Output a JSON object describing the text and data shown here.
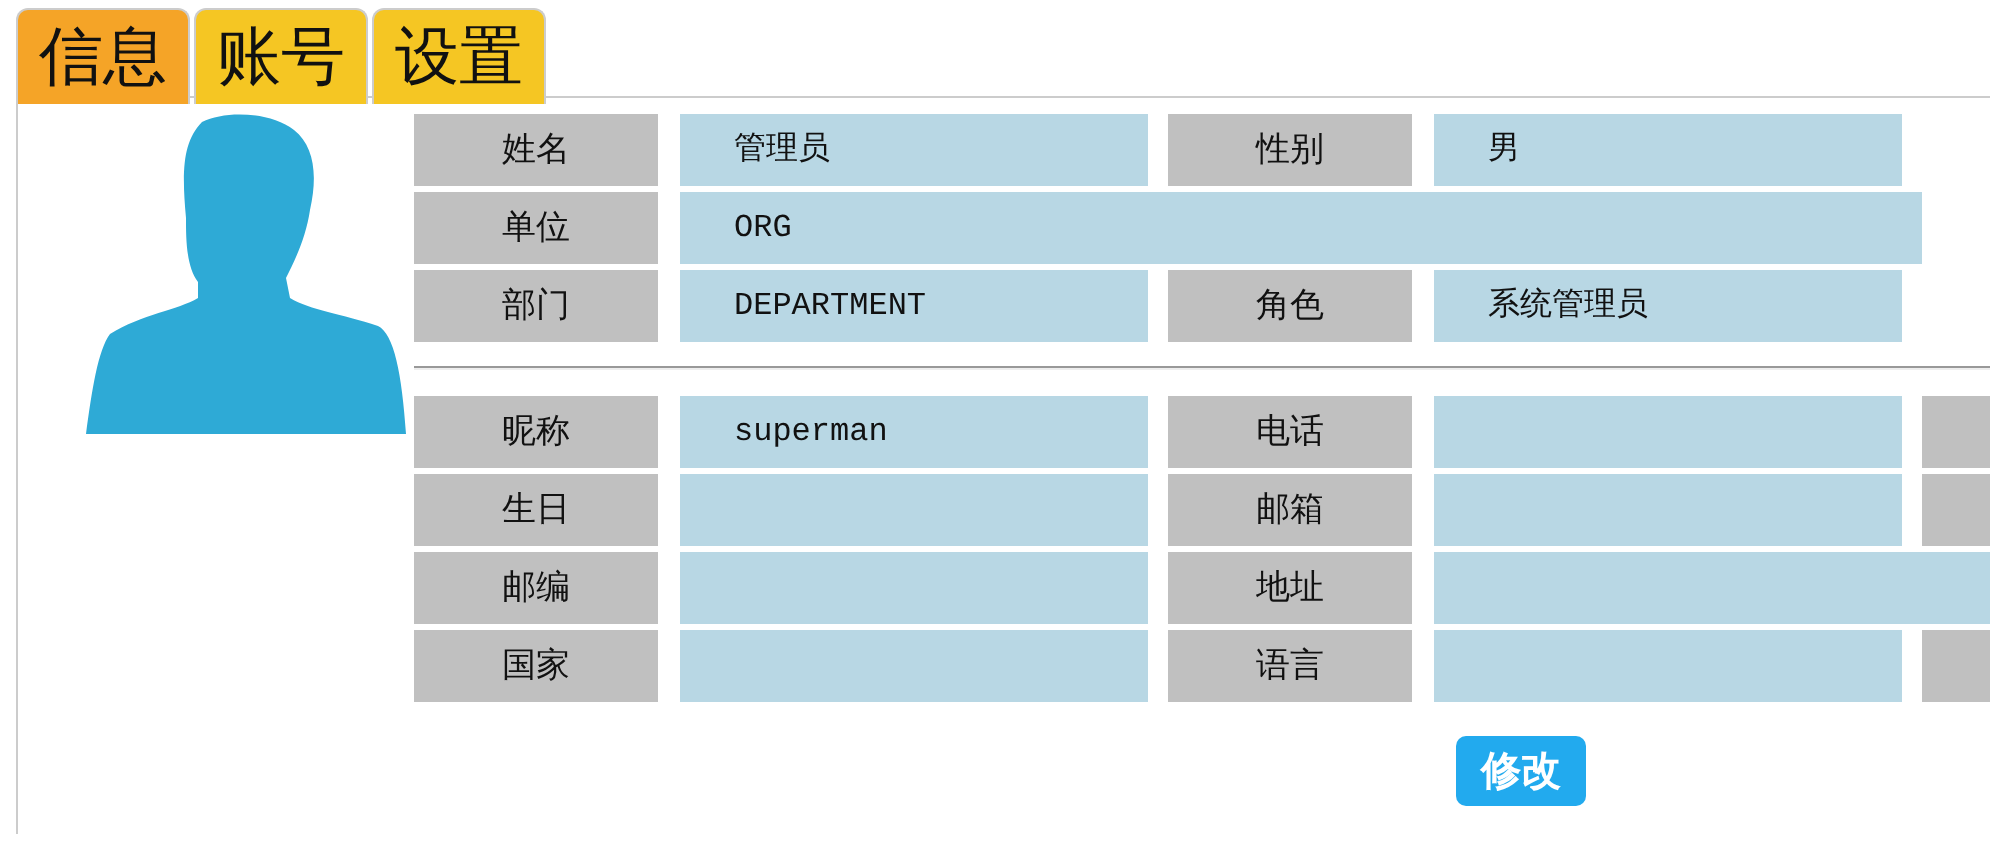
{
  "tabs": [
    {
      "label": "信息",
      "selected": true
    },
    {
      "label": "账号",
      "selected": false
    },
    {
      "label": "设置",
      "selected": false
    }
  ],
  "sections": [
    {
      "rows": [
        {
          "cells": [
            {
              "kind": "label",
              "text": "姓名"
            },
            {
              "kind": "value",
              "text": "管理员"
            },
            {
              "kind": "label",
              "text": "性别"
            },
            {
              "kind": "value",
              "text": "男"
            }
          ]
        },
        {
          "cells": [
            {
              "kind": "label",
              "text": "单位"
            },
            {
              "kind": "wide",
              "text": "ORG"
            }
          ]
        },
        {
          "cells": [
            {
              "kind": "label",
              "text": "部门"
            },
            {
              "kind": "value",
              "text": "DEPARTMENT"
            },
            {
              "kind": "label",
              "text": "角色"
            },
            {
              "kind": "value",
              "text": "系统管理员"
            }
          ]
        }
      ]
    },
    {
      "rows": [
        {
          "cells": [
            {
              "kind": "label",
              "text": "昵称"
            },
            {
              "kind": "value",
              "text": "superman"
            },
            {
              "kind": "label",
              "text": "电话"
            },
            {
              "kind": "value"
            },
            {
              "kind": "label"
            }
          ]
        },
        {
          "cells": [
            {
              "kind": "label",
              "text": "生日"
            },
            {
              "kind": "value"
            },
            {
              "kind": "label",
              "text": "邮箱"
            },
            {
              "kind": "value"
            },
            {
              "kind": "label"
            }
          ]
        },
        {
          "cells": [
            {
              "kind": "label",
              "text": "邮编"
            },
            {
              "kind": "value"
            },
            {
              "kind": "label",
              "text": "地址"
            },
            {
              "kind": "wide"
            }
          ]
        },
        {
          "cells": [
            {
              "kind": "label",
              "text": "国家"
            },
            {
              "kind": "value"
            },
            {
              "kind": "label",
              "text": "语言"
            },
            {
              "kind": "value"
            },
            {
              "kind": "label"
            }
          ]
        }
      ]
    }
  ],
  "button": "修改"
}
